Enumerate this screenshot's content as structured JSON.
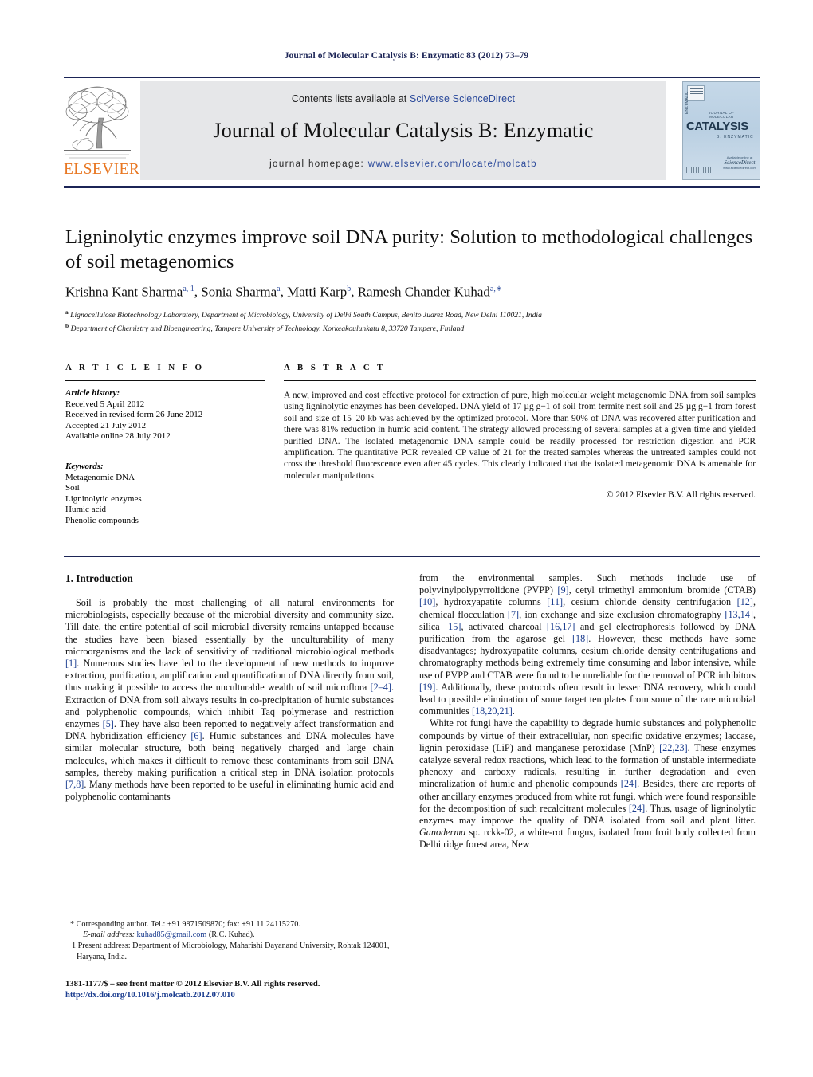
{
  "running_head": "Journal of Molecular Catalysis B: Enzymatic 83 (2012) 73–79",
  "masthead": {
    "contents_prefix": "Contents lists available at ",
    "contents_link": "SciVerse ScienceDirect",
    "journal_title": "Journal of Molecular Catalysis B: Enzymatic",
    "homepage_prefix": "journal homepage: ",
    "homepage_url": "www.elsevier.com/locate/molcatb",
    "publisher_wordmark": "ELSEVIER",
    "cover": {
      "line1": "JOURNAL OF MOLECULAR",
      "line2": "CATALYSIS",
      "line3": "B: ENZYMATIC",
      "side_label": "ENZYMATIC",
      "foot_a": "Available online at",
      "foot_b": "ScienceDirect",
      "foot_c": "www.sciencedirect.com"
    },
    "accent_link_color": "#2b4a9b",
    "elsevier_orange": "#e87722",
    "cover_blue": "#bcd2e4"
  },
  "article": {
    "title": "Ligninolytic enzymes improve soil DNA purity: Solution to methodological challenges of soil metagenomics",
    "authors_html": "Krishna Kant Sharma<sup>a, 1</sup>, Sonia Sharma<sup>a</sup>, Matti Karp<sup>b</sup>, Ramesh Chander Kuhad<sup>a,∗</sup>",
    "affiliation_a": "Lignocellulose Biotechnology Laboratory, Department of Microbiology, University of Delhi South Campus, Benito Juarez Road, New Delhi 110021, India",
    "affiliation_b": "Department of Chemistry and Bioengineering, Tampere University of Technology, Korkeakoulunkatu 8, 33720 Tampere, Finland"
  },
  "article_info": {
    "heading": "A R T I C L E   I N F O",
    "history_label": "Article history:",
    "history": [
      "Received 5 April 2012",
      "Received in revised form 26 June 2012",
      "Accepted 21 July 2012",
      "Available online 28 July 2012"
    ],
    "keywords_label": "Keywords:",
    "keywords": [
      "Metagenomic DNA",
      "Soil",
      "Ligninolytic enzymes",
      "Humic acid",
      "Phenolic compounds"
    ]
  },
  "abstract": {
    "heading": "A B S T R A C T",
    "body": "A new, improved and cost effective protocol for extraction of pure, high molecular weight metagenomic DNA from soil samples using ligninolytic enzymes has been developed. DNA yield of 17 µg g−1 of soil from termite nest soil and 25 µg g−1 from forest soil and size of 15–20 kb was achieved by the optimized protocol. More than 90% of DNA was recovered after purification and there was 81% reduction in humic acid content. The strategy allowed processing of several samples at a given time and yielded purified DNA. The isolated metagenomic DNA sample could be readily processed for restriction digestion and PCR amplification. The quantitative PCR revealed CP value of 21 for the treated samples whereas the untreated samples could not cross the threshold fluorescence even after 45 cycles. This clearly indicated that the isolated metagenomic DNA is amenable for molecular manipulations.",
    "copyright": "© 2012 Elsevier B.V. All rights reserved."
  },
  "introduction": {
    "heading": "1.  Introduction",
    "left_paragraph_1": "Soil is probably the most challenging of all natural environments for microbiologists, especially because of the microbial diversity and community size. Till date, the entire potential of soil microbial diversity remains untapped because the studies have been biased essentially by the unculturability of many microorganisms and the lack of sensitivity of traditional microbiological methods [1]. Numerous studies have led to the development of new methods to improve extraction, purification, amplification and quantification of DNA directly from soil, thus making it possible to access the unculturable wealth of soil microflora [2–4]. Extraction of DNA from soil always results in co-precipitation of humic substances and polyphenolic compounds, which inhibit Taq polymerase and restriction enzymes [5]. They have also been reported to negatively affect transformation and DNA hybridization efficiency [6]. Humic substances and DNA molecules have similar molecular structure, both being negatively charged and large chain molecules, which makes it difficult to remove these contaminants from soil DNA samples, thereby making purification a critical step in DNA isolation protocols [7,8]. Many methods have been reported to be useful in eliminating humic acid and polyphenolic contaminants",
    "right_paragraph_1": "from the environmental samples. Such methods include use of polyvinylpolypyrrolidone (PVPP) [9], cetyl trimethyl ammonium bromide (CTAB) [10], hydroxyapatite columns [11], cesium chloride density centrifugation [12], chemical flocculation [7], ion exchange and size exclusion chromatography [13,14], silica [15], activated charcoal [16,17] and gel electrophoresis followed by DNA purification from the agarose gel [18]. However, these methods have some disadvantages; hydroxyapatite columns, cesium chloride density centrifugations and chromatography methods being extremely time consuming and labor intensive, while use of PVPP and CTAB were found to be unreliable for the removal of PCR inhibitors [19]. Additionally, these protocols often result in lesser DNA recovery, which could lead to possible elimination of some target templates from some of the rare microbial communities [18,20,21].",
    "right_paragraph_2": "White rot fungi have the capability to degrade humic substances and polyphenolic compounds by virtue of their extracellular, non specific oxidative enzymes; laccase, lignin peroxidase (LiP) and manganese peroxidase (MnP) [22,23]. These enzymes catalyze several redox reactions, which lead to the formation of unstable intermediate phenoxy and carboxy radicals, resulting in further degradation and even mineralization of humic and phenolic compounds [24]. Besides, there are reports of other ancillary enzymes produced from white rot fungi, which were found responsible for the decomposition of such recalcitrant molecules [24]. Thus, usage of ligninolytic enzymes may improve the quality of DNA isolated from soil and plant litter. Ganoderma sp. rckk-02, a white-rot fungus, isolated from fruit body collected from Delhi ridge forest area, New"
  },
  "footnotes": {
    "corresponding": "* Corresponding author. Tel.: +91 9871509870; fax: +91 11 24115270.",
    "email_label": "E-mail address:",
    "email": "kuhad85@gmail.com",
    "email_suffix": "(R.C. Kuhad).",
    "present_address": "1 Present address: Department of Microbiology, Maharishi Dayanand University, Rohtak 124001, Haryana, India."
  },
  "footer": {
    "line1": "1381-1177/$ – see front matter © 2012 Elsevier B.V. All rights reserved.",
    "doi": "http://dx.doi.org/10.1016/j.molcatb.2012.07.010"
  }
}
